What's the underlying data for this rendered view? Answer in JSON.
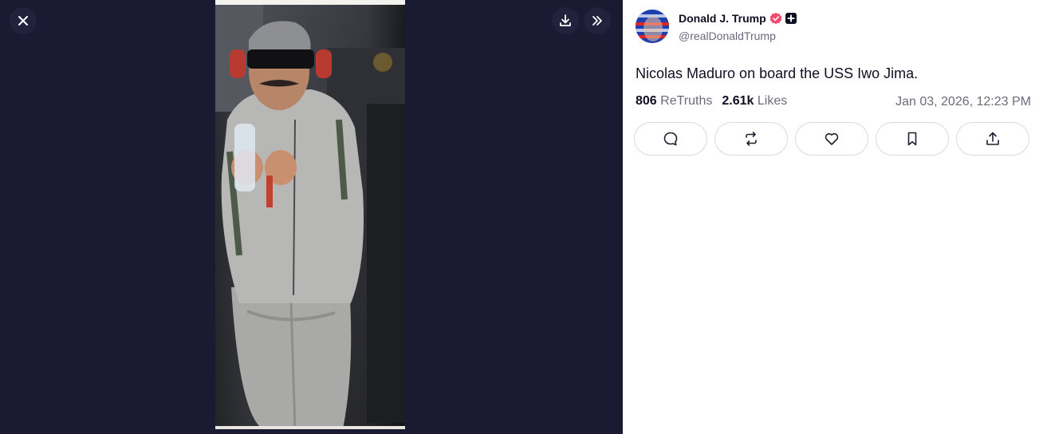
{
  "viewer": {
    "close_icon": "close-icon",
    "download_icon": "download-icon",
    "expand_icon": "chevrons-right-icon",
    "background_color": "#1b1a33",
    "photo_description": "media-image"
  },
  "post": {
    "author_name": "Donald J. Trump",
    "author_handle": "@realDonaldTrump",
    "verified_icon": "verified-badge-icon",
    "verified_color": "#ef4b6c",
    "plus_icon": "plus-badge-icon",
    "text": "Nicolas Maduro on board the USS Iwo Jima.",
    "retruths_count": "806",
    "retruths_label": "ReTruths",
    "likes_count": "2.61k",
    "likes_label": "Likes",
    "timestamp": "Jan 03, 2026, 12:23 PM"
  },
  "actions": [
    {
      "icon": "reply-icon"
    },
    {
      "icon": "retruth-icon"
    },
    {
      "icon": "like-icon"
    },
    {
      "icon": "bookmark-icon"
    },
    {
      "icon": "share-icon"
    }
  ]
}
